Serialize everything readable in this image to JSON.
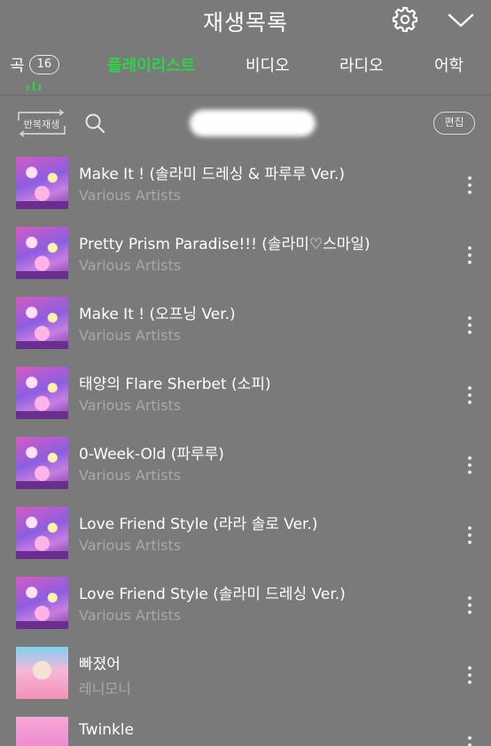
{
  "header": {
    "title": "재생목록"
  },
  "tabs": {
    "songs_label": "곡",
    "songs_count": "16",
    "playlist": "플레이리스트",
    "video": "비디오",
    "radio": "라디오",
    "language": "어학"
  },
  "toolbar": {
    "repeat_label": "반복재생",
    "edit_label": "편집"
  },
  "songs": [
    {
      "title": "Make It ! (솔라미 드레싱 & 파루루 Ver.)",
      "artist": "Various Artists"
    },
    {
      "title": "Pretty Prism Paradise!!! (솔라미♡스마일)",
      "artist": "Various Artists"
    },
    {
      "title": "Make It ! (오프닝 Ver.)",
      "artist": "Various Artists"
    },
    {
      "title": "태양의 Flare Sherbet (소피)",
      "artist": "Various Artists"
    },
    {
      "title": "0-Week-Old (파루루)",
      "artist": "Various Artists"
    },
    {
      "title": "Love Friend Style (라라 솔로 Ver.)",
      "artist": "Various Artists"
    },
    {
      "title": "Love Friend Style (솔라미 드레싱 Ver.)",
      "artist": "Various Artists"
    },
    {
      "title": "빠졌어",
      "artist": "레니모니"
    },
    {
      "title": "Twinkle",
      "artist": ""
    }
  ],
  "colors": {
    "background": "#7a7a7a",
    "accent": "#2fd24a",
    "secondary_text": "#a8a8a8"
  },
  "icons": [
    "gear-icon",
    "chevron-down-icon",
    "equalizer-icon",
    "repeat-icon",
    "search-icon",
    "more-icon"
  ]
}
